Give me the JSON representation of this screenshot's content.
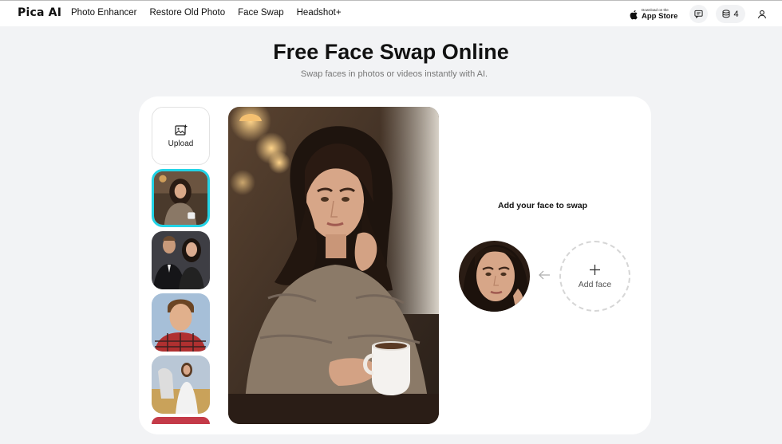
{
  "header": {
    "logo": "Pica AI",
    "nav": [
      "Photo Enhancer",
      "Restore Old Photo",
      "Face Swap",
      "Headshot+"
    ],
    "app_store_small": "Download on the",
    "app_store_big": "App Store",
    "credits": "4"
  },
  "hero": {
    "title": "Free Face Swap Online",
    "subtitle": "Swap faces in photos or videos instantly with AI."
  },
  "panel": {
    "upload_label": "Upload",
    "add_face_title": "Add your face to swap",
    "add_face_label": "Add face"
  },
  "colors": {
    "accent": "#22d3e6",
    "background": "#f2f3f5"
  }
}
